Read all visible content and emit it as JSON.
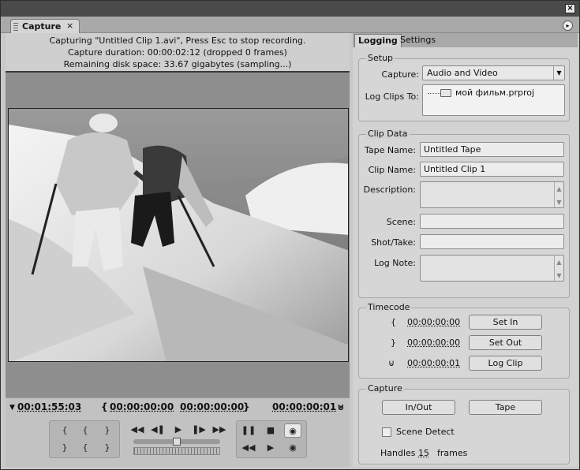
{
  "window": {
    "close_glyph": "×",
    "tab_title": "Capture",
    "tab_close_glyph": "×",
    "panel_menu_glyph": "▸"
  },
  "status": {
    "line1": "Capturing \"Untitled Clip 1.avi\", Press Esc to stop recording.",
    "line2": "Capture duration: 00:00:02:12  (dropped 0 frames)",
    "line3": "Remaining disk space: 33.67 gigabytes (sampling...)"
  },
  "timecodes_bar": {
    "current": "00:01:55:03",
    "in_point": "00:00:00:00",
    "out_point": "00:00:00:00",
    "duration": "00:00:00:01"
  },
  "right_panel": {
    "tabs": [
      {
        "label": "Logging",
        "active": true
      },
      {
        "label": "Settings",
        "active": false
      }
    ],
    "setup": {
      "title": "Setup",
      "capture_label": "Capture:",
      "capture_value": "Audio and Video",
      "log_clips_label": "Log Clips To:",
      "log_clips_item": "мой фильм.prproj"
    },
    "clip_data": {
      "title": "Clip Data",
      "tape_name_label": "Tape Name:",
      "tape_name_value": "Untitled Tape",
      "clip_name_label": "Clip Name:",
      "clip_name_value": "Untitled Clip 1",
      "description_label": "Description:",
      "scene_label": "Scene:",
      "shot_label": "Shot/Take:",
      "log_note_label": "Log Note:"
    },
    "timecode": {
      "title": "Timecode",
      "in_value": "00:00:00:00",
      "out_value": "00:00:00:00",
      "duration_value": "00:00:00:01",
      "set_in": "Set In",
      "set_out": "Set Out",
      "log_clip": "Log Clip"
    },
    "capture": {
      "title": "Capture",
      "in_out": "In/Out",
      "tape": "Tape",
      "scene_detect_label": "Scene Detect",
      "scene_detect_checked": false,
      "handles_label": "Handles",
      "handles_value": "15",
      "handles_unit": "frames"
    }
  },
  "icons": {
    "in_mark": "{",
    "out_mark": "}",
    "duration_mark": "⊍",
    "play": "▶",
    "stop": "■",
    "pause": "❚❚",
    "rewind": "◀◀",
    "ffwd": "▶▶",
    "step_back": "◀❚",
    "step_fwd": "❚▶",
    "record": "◉",
    "up_arrow": "▲",
    "down_arrow": "▼",
    "dropdown": "▼"
  }
}
